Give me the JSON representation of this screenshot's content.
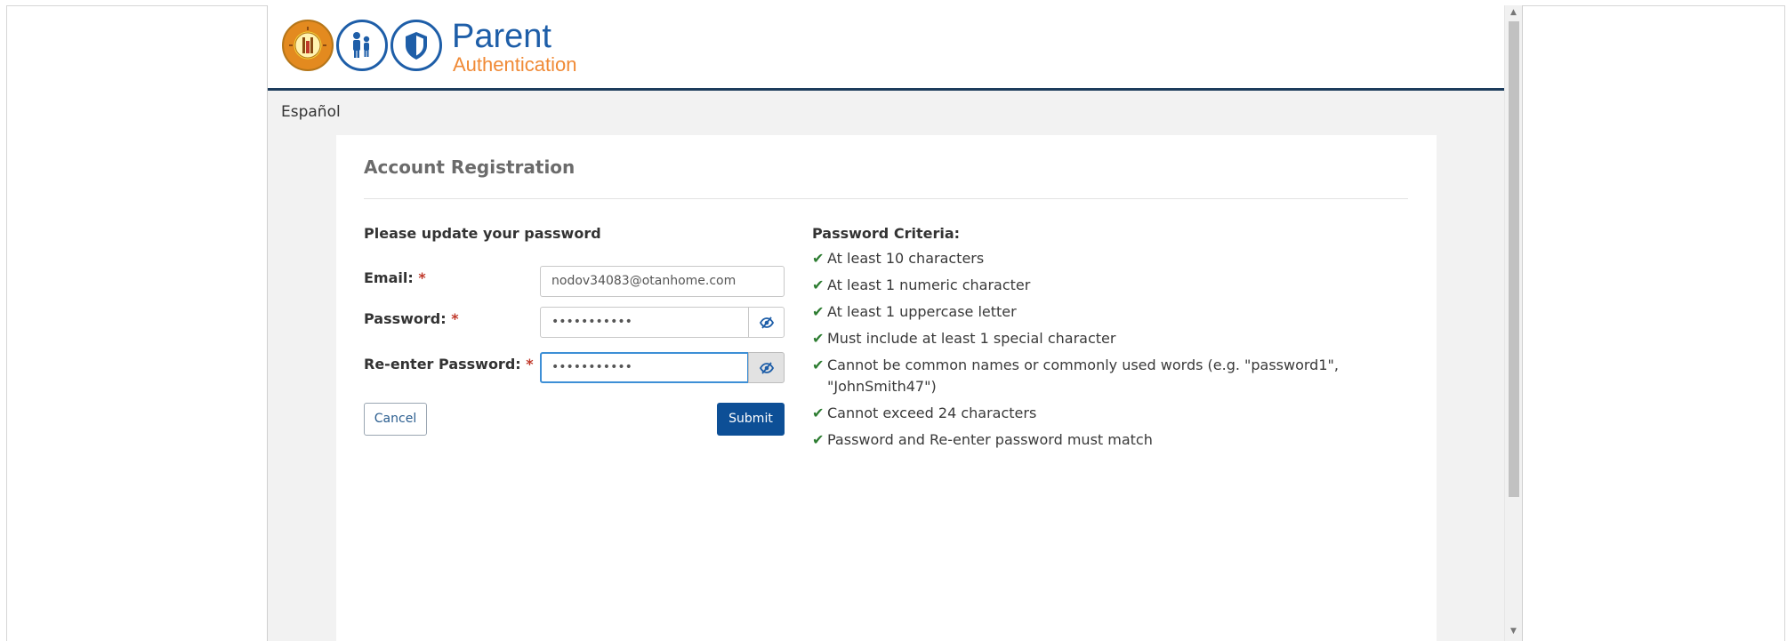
{
  "header": {
    "brand_title": "Parent",
    "brand_subtitle": "Authentication",
    "logo_icons": [
      "district-seal-icon",
      "parent-child-icon",
      "shield-icon"
    ]
  },
  "language_link": "Español",
  "form": {
    "heading": "Account Registration",
    "section_title": "Please update your password",
    "email": {
      "label": "Email:",
      "required_mark": "*",
      "value": "nodov34083@otanhome.com"
    },
    "password": {
      "label": "Password:",
      "required_mark": "*",
      "value": "•••••••••••"
    },
    "reenter_password": {
      "label": "Re-enter Password:",
      "required_mark": "*",
      "value": "•••••••••••"
    },
    "cancel_label": "Cancel",
    "submit_label": "Submit"
  },
  "criteria": {
    "title": "Password Criteria:",
    "check_glyph": "✔",
    "items": [
      "At least 10 characters",
      "At least 1 numeric character",
      "At least 1 uppercase letter",
      "Must include at least 1 special character",
      "Cannot be common names or commonly used words (e.g. \"password1\", \"JohnSmith47\")",
      "Cannot exceed 24 characters",
      "Password and Re-enter password must match"
    ]
  },
  "colors": {
    "brand_blue": "#1e5ea8",
    "brand_orange": "#f08a36",
    "submit_bg": "#0d4f96",
    "check_green": "#2e7d32",
    "required_red": "#c0392b"
  }
}
